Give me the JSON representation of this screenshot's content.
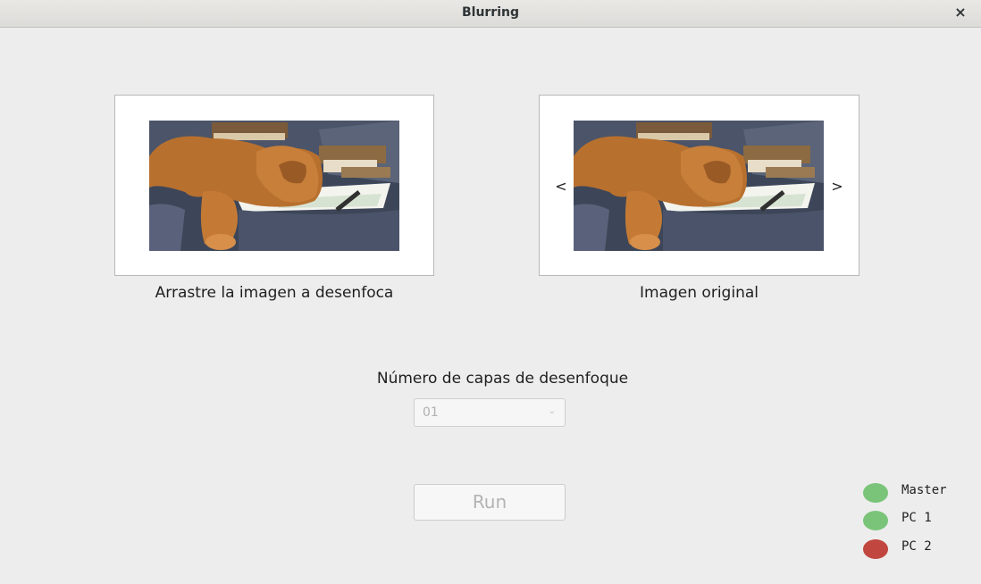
{
  "window": {
    "title": "Blurring",
    "close_glyph": "×"
  },
  "images": {
    "left": {
      "caption": "Arrastre la imagen a desenfoca",
      "icon": "dog-photo"
    },
    "right": {
      "caption": "Imagen original",
      "icon": "dog-photo",
      "prev_glyph": "<",
      "next_glyph": ">"
    }
  },
  "blur_layers": {
    "label": "Número de capas de desenfoque",
    "selected": "01",
    "chevron_glyph": "⌄"
  },
  "run_button": {
    "label": "Run"
  },
  "nodes": [
    {
      "label": "Master",
      "status_color": "#7ac47a"
    },
    {
      "label": "PC 1",
      "status_color": "#7ac47a"
    },
    {
      "label": "PC 2",
      "status_color": "#c0463f"
    }
  ]
}
